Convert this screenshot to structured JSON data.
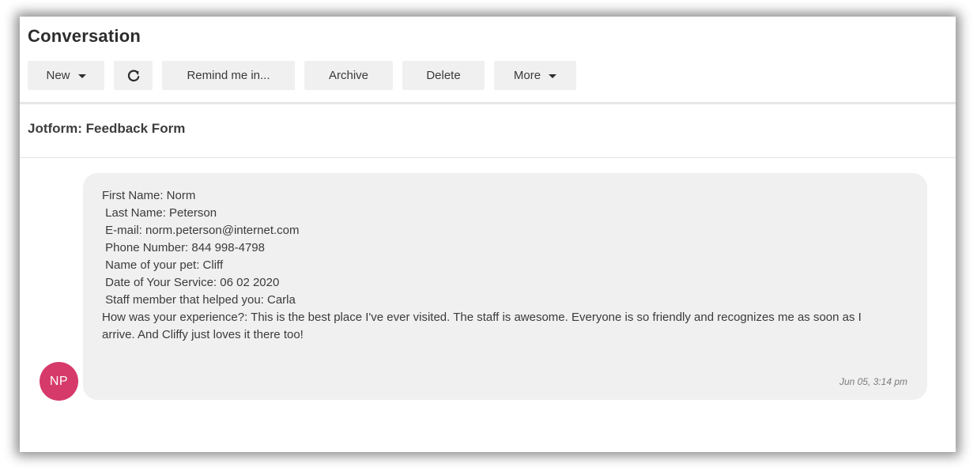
{
  "header": {
    "title": "Conversation"
  },
  "toolbar": {
    "new_label": "New",
    "refresh_icon": "refresh-icon",
    "remind_label": "Remind me in...",
    "archive_label": "Archive",
    "delete_label": "Delete",
    "more_label": "More"
  },
  "conversation": {
    "subject": "Jotform: Feedback Form",
    "message": {
      "lines": [
        "First Name: Norm",
        " Last Name: Peterson",
        " E-mail: norm.peterson@internet.com",
        " Phone Number: 844 998-4798",
        " Name of your pet: Cliff",
        " Date of Your Service: 06 02 2020",
        " Staff member that helped you: Carla",
        " How was your experience?: This is the best place I've ever visited. The staff is awesome. Everyone is so friendly and recognizes me as soon as I arrive. And Cliffy just loves it there too!"
      ],
      "timestamp": "Jun 05, 3:14 pm"
    },
    "avatar": {
      "initials": "NP",
      "color": "#d63a6b"
    }
  }
}
